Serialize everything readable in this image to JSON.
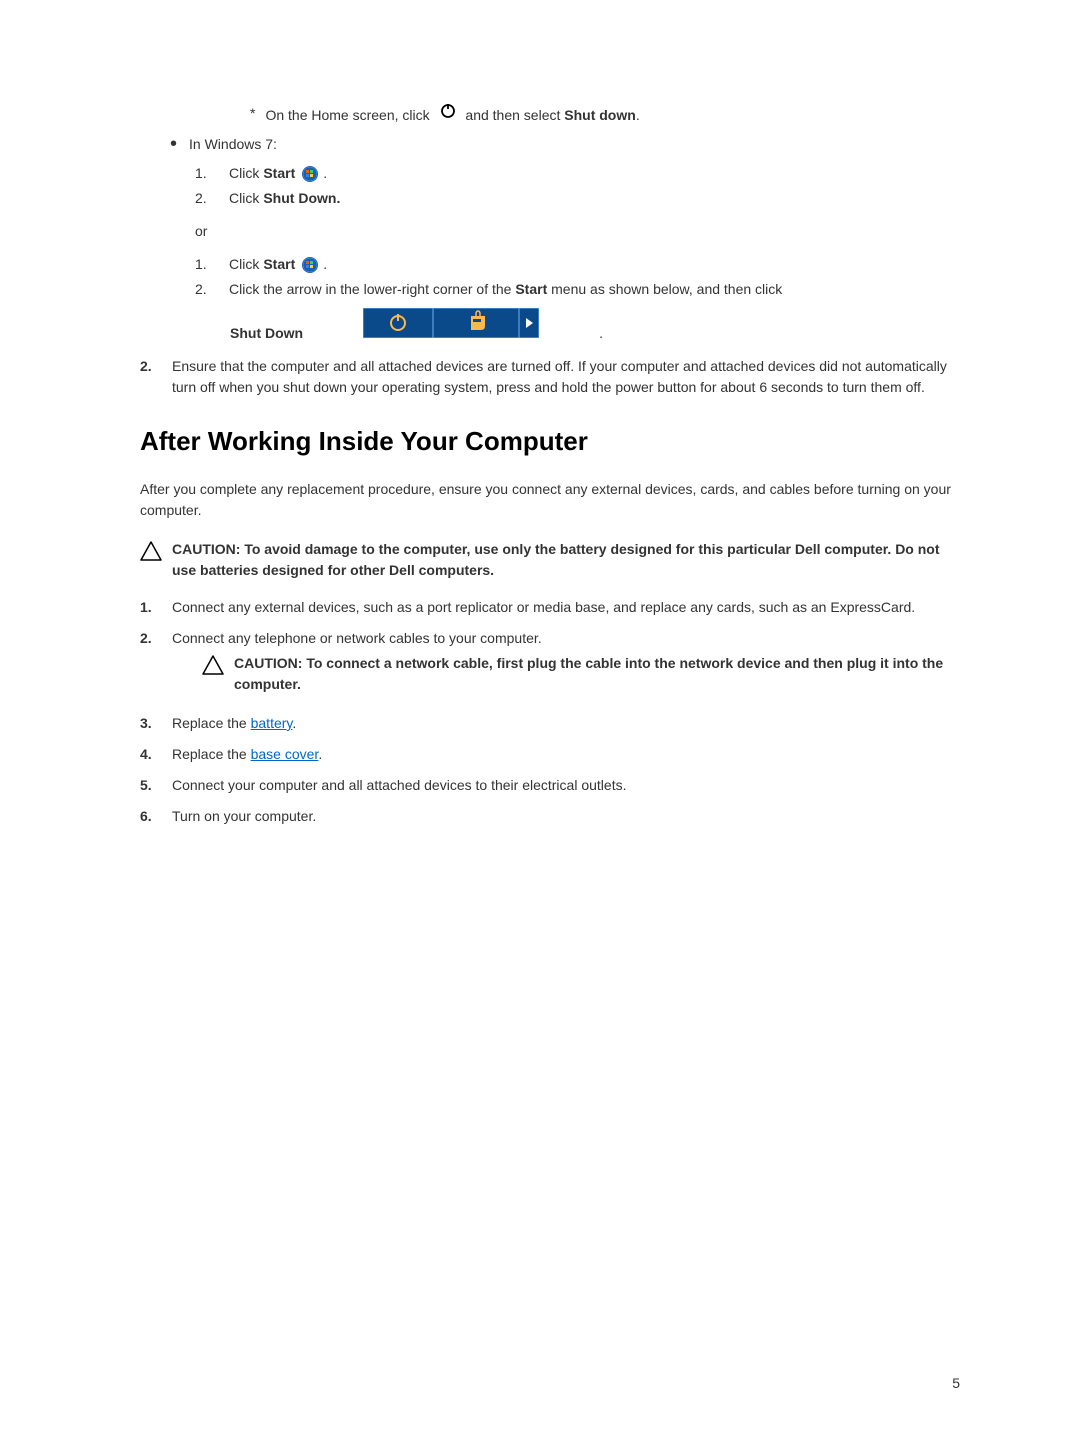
{
  "sub_bullet": {
    "marker": "*",
    "text_before": "On the Home screen, click",
    "text_after": "and then select",
    "shut_down": "Shut down"
  },
  "bullet": {
    "win7": "In Windows 7:"
  },
  "numlist1": {
    "item1_num": "1.",
    "item1_prefix": "Click",
    "item1_bold": "Start",
    "item2_num": "2.",
    "item2_prefix": "Click",
    "item2_bold": "Shut Down."
  },
  "or": "or",
  "numlist2": {
    "item1_num": "1.",
    "item1_prefix": "Click",
    "item1_bold": "Start",
    "item2_num": "2.",
    "item2_text_before": "Click the arrow in the lower-right corner of the",
    "item2_bold": "Start",
    "item2_text_after": "menu as shown below, and then click"
  },
  "shutdown_label": "Shut Down",
  "main2": {
    "num": "2.",
    "text": "Ensure that the computer and all attached devices are turned off. If your computer and attached devices did not automatically turn off when you shut down your operating system, press and hold the power button for about 6 seconds to turn them off."
  },
  "heading": "After Working Inside Your Computer",
  "intro_para": "After you complete any replacement procedure, ensure you connect any external devices, cards, and cables before turning on your computer.",
  "caution1": "CAUTION: To avoid damage to the computer, use only the battery designed for this particular Dell computer. Do not use batteries designed for other Dell computers.",
  "steps": {
    "s1_num": "1.",
    "s1_text": "Connect any external devices, such as a port replicator or media base, and replace any cards, such as an ExpressCard.",
    "s2_num": "2.",
    "s2_text": "Connect any telephone or network cables to your computer.",
    "caution2": "CAUTION: To connect a network cable, first plug the cable into the network device and then plug it into the computer.",
    "s3_num": "3.",
    "s3_prefix": "Replace the ",
    "s3_link": "battery",
    "s4_num": "4.",
    "s4_prefix": "Replace the ",
    "s4_link": "base cover",
    "s5_num": "5.",
    "s5_text": "Connect your computer and all attached devices to their electrical outlets.",
    "s6_num": "6.",
    "s6_text": "Turn on your computer."
  },
  "page_number": "5"
}
